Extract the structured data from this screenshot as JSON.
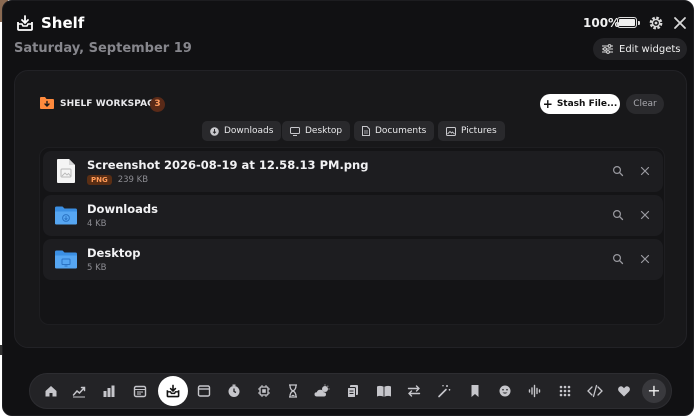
{
  "app": {
    "title": "Shelf",
    "battery_percent": "100%"
  },
  "header": {
    "date": "Saturday, September 19",
    "edit_widgets_label": "Edit widgets"
  },
  "workspace": {
    "title": "SHELF WORKSPACE",
    "count": "3",
    "stash_label": "Stash File...",
    "clear_label": "Clear",
    "accent_color": "#ff8a3d",
    "quick_links": [
      {
        "label": "Downloads",
        "icon": "download-circle-icon"
      },
      {
        "label": "Desktop",
        "icon": "monitor-icon"
      },
      {
        "label": "Documents",
        "icon": "document-icon"
      },
      {
        "label": "Pictures",
        "icon": "picture-icon"
      }
    ],
    "files": [
      {
        "name": "Screenshot 2026-08-19 at 12.58.13 PM.png",
        "type": "PNG",
        "size": "239 KB",
        "icon": "png-file-icon"
      },
      {
        "name": "Downloads",
        "type": "",
        "size": "4 KB",
        "icon": "folder-icon"
      },
      {
        "name": "Desktop",
        "type": "",
        "size": "5 KB",
        "icon": "folder-icon"
      }
    ]
  },
  "dock": {
    "items": [
      "home-icon",
      "chart-line-icon",
      "bar-chart-icon",
      "calendar-icon",
      "shelf-icon",
      "window-icon",
      "timer-icon",
      "cpu-icon",
      "hourglass-icon",
      "weather-icon",
      "clipboard-icon",
      "book-icon",
      "arrows-swap-icon",
      "magic-wand-icon",
      "bookmark-icon",
      "emoji-icon",
      "waveform-icon",
      "grid-icon",
      "code-icon",
      "heart-icon",
      "add-icon"
    ],
    "active": "shelf-icon"
  }
}
